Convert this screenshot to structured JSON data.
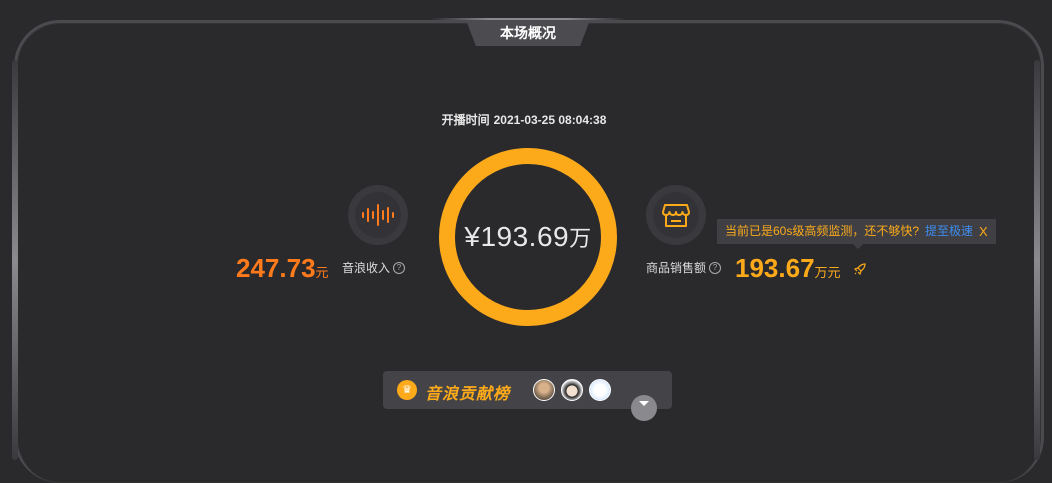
{
  "header": {
    "title": "本场概况"
  },
  "session": {
    "start_label": "开播时间",
    "start_time": "2021-03-25 08:04:38"
  },
  "center": {
    "currency": "¥",
    "amount": "193.69",
    "unit": "万"
  },
  "left_metric": {
    "value": "247.73",
    "unit": "元",
    "label": "音浪收入",
    "icon": "sound-wave-icon"
  },
  "right_metric": {
    "value": "193.67",
    "unit": "万元",
    "label": "商品销售额",
    "icon": "store-icon",
    "extra_icon": "rocket-icon"
  },
  "tooltip": {
    "text": "当前已是60s级高频监测，还不够快?",
    "link": "提至极速",
    "close": "X"
  },
  "ranking": {
    "crown_icon": "crown-icon",
    "title": "音浪贡献榜",
    "expand_icon": "chevron-down-icon"
  },
  "colors": {
    "accent": "#fcaa1a",
    "orange": "#ff7a1a",
    "link": "#3d8cf0",
    "background": "#2a2a2d"
  }
}
